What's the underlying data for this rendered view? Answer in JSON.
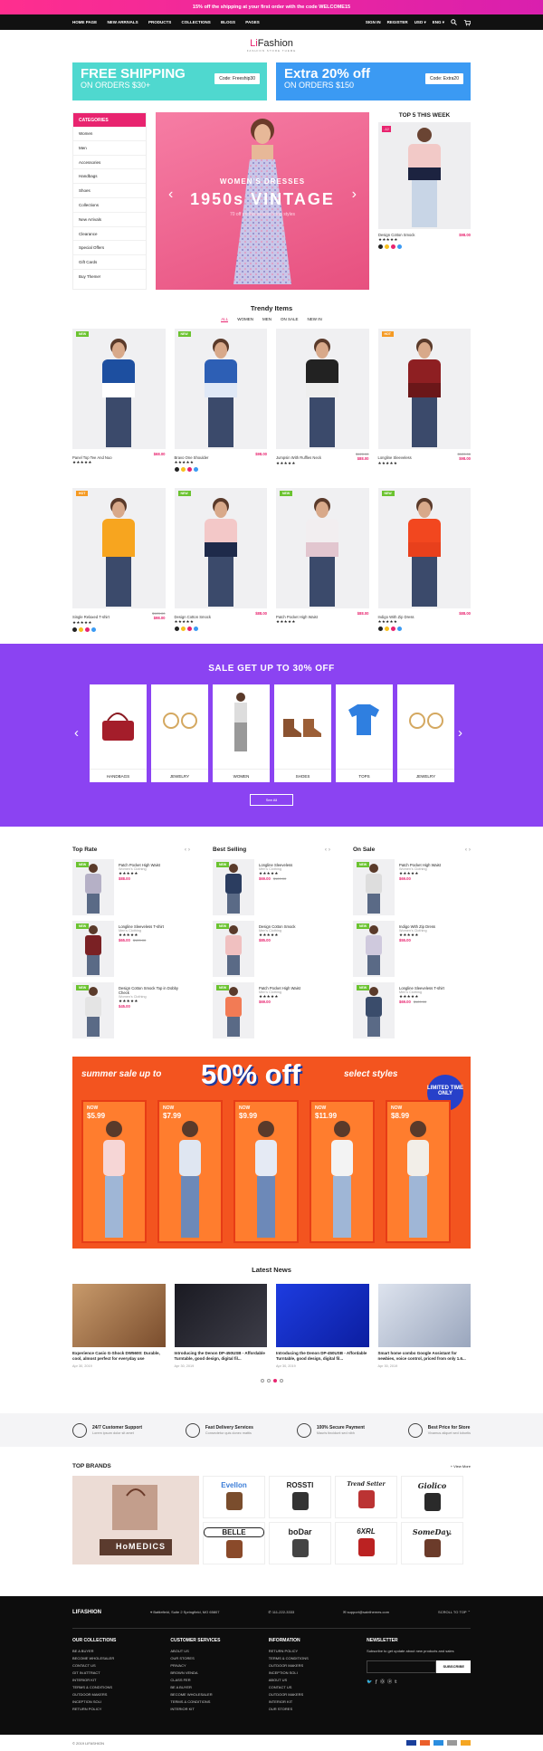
{
  "topbar": {
    "text": "15% off the shipping at your first order with the code WELCOME15"
  },
  "nav": {
    "links": [
      "HOME PAGE",
      "NEW ARRIVALS",
      "PRODUCTS",
      "COLLECTIONS",
      "BLOGS",
      "PAGES"
    ],
    "signin": "SIGN IN",
    "register": "REGISTER",
    "currency": "USD",
    "language": "ENG"
  },
  "logo": {
    "prefix": "Li",
    "name": "Fashion",
    "tagline": "FASHION STORE THEME"
  },
  "promos": [
    {
      "big": "FREE SHIPPING",
      "small": "ON ORDERS $30+",
      "code": "Code: Freeship30",
      "color": "#4fd8cf"
    },
    {
      "big": "Extra 20% off",
      "small": "ON ORDERS $150",
      "code": "Code: Extra20",
      "color": "#3b9af3"
    }
  ],
  "categories": {
    "title": "CATEGORIES",
    "items": [
      "Women",
      "Men",
      "Accessories",
      "Handbags",
      "Shoes",
      "Collections",
      "New Arrivals",
      "Clearance",
      "Special Offers",
      "Gift Cards",
      "Buy Theme!"
    ]
  },
  "banner": {
    "line1": "WOMEN'S DRESSES",
    "line2": "1950s VINTAGE",
    "line3": "70 off on this season's top styles"
  },
  "top5": {
    "title": "TOP 5 THIS WEEK",
    "discount": "-12",
    "name": "Design Cotton Smock",
    "price": "$98.00"
  },
  "trendy": {
    "title": "Trendy Items",
    "tabs": [
      "ALL",
      "WOMEN",
      "MEN",
      "ON SALE",
      "NEW IN"
    ],
    "products": [
      {
        "name": "Panel Top Tee And Nuo",
        "price": "$68.00",
        "old": "",
        "badge": "NEW",
        "btype": "new",
        "bg": "#eef0f3",
        "c1": "#1d4fa0",
        "c2": "#fff"
      },
      {
        "name": "Bravo One Shoulder",
        "price": "$98.00",
        "old": "",
        "badge": "NEW",
        "btype": "new",
        "bg": "#eef0f3",
        "c1": "#2d5fb5",
        "c2": "#dfe8f6"
      },
      {
        "name": "Jumpsin With Ruffles Neck",
        "price": "$88.00",
        "old": "$120.00",
        "badge": "",
        "btype": "",
        "bg": "#eef0f3",
        "c1": "#222",
        "c2": "#eee"
      },
      {
        "name": "Longline Sleeveless",
        "price": "$98.00",
        "old": "$120.00",
        "badge": "HOT",
        "btype": "hot",
        "bg": "#eef0f3",
        "c1": "#8e1f22",
        "c2": "#6b1719"
      },
      {
        "name": "Single Relaxed T-shirt",
        "price": "$98.00",
        "old": "$120.00",
        "badge": "HOT",
        "btype": "hot",
        "bg": "#eef0f3",
        "c1": "#f7a51f",
        "c2": "#f7a51f"
      },
      {
        "name": "Design Cotton Smock",
        "price": "$88.00",
        "old": "",
        "badge": "NEW",
        "btype": "new",
        "bg": "#eef0f3",
        "c1": "#f3c8c8",
        "c2": "#1e2a4a"
      },
      {
        "name": "Patch Pocket High Waist",
        "price": "$88.00",
        "old": "",
        "badge": "NEW",
        "btype": "new",
        "bg": "#eef0f3",
        "c1": "#f2eef0",
        "c2": "#e2c6cf"
      },
      {
        "name": "Indigo With Zip Dress",
        "price": "$88.00",
        "old": "",
        "badge": "NEW",
        "btype": "new",
        "bg": "#eef0f3",
        "c1": "#f2471f",
        "c2": "#e8401c"
      }
    ]
  },
  "sale": {
    "title": "SALE GET UP TO 30% OFF",
    "cats": [
      "HANDBAGS",
      "JEWELRY",
      "WOMEN",
      "SHOES",
      "TOPS",
      "JEWELRY"
    ],
    "see_all": "See All"
  },
  "lists": [
    {
      "title": "Top Rate",
      "items": [
        {
          "name": "Patch Pocket High Waist",
          "cat": "Women's Clothing",
          "price": "$88.00",
          "old": "",
          "badge": "NEW"
        },
        {
          "name": "Longline Sleeveless T-shirt",
          "cat": "Men's Clothing",
          "price": "$65.00",
          "old": "$120.00",
          "badge": "NEW"
        },
        {
          "name": "Design Cotton Smock Top in Dobby Check",
          "cat": "Women's Clothing",
          "price": "$45.00",
          "old": "",
          "badge": "NEW"
        }
      ]
    },
    {
      "title": "Best Selling",
      "items": [
        {
          "name": "Longline Sleeveless",
          "cat": "Men's Clothing",
          "price": "$69.00",
          "old": "$120.00",
          "badge": "NEW"
        },
        {
          "name": "Design Cotton Smock",
          "cat": "Men's Clothing",
          "price": "$85.00",
          "old": "",
          "badge": "NEW"
        },
        {
          "name": "Patch Pocket High Waist",
          "cat": "Men's Clothing",
          "price": "$69.00",
          "old": "",
          "badge": "NEW"
        }
      ]
    },
    {
      "title": "On Sale",
      "items": [
        {
          "name": "Patch Pocket High Waist",
          "cat": "Women's Clothing",
          "price": "$69.00",
          "old": "",
          "badge": "NEW"
        },
        {
          "name": "Indigo With Zip Dress",
          "cat": "Women's Clothing",
          "price": "$55.00",
          "old": "",
          "badge": "NEW"
        },
        {
          "name": "Longline Sleeveless T-shirt",
          "cat": "Men's Clothing",
          "price": "$69.00",
          "old": "$120.00",
          "badge": "NEW"
        }
      ]
    }
  ],
  "summer": {
    "small": "summer sale up to",
    "big": "50% off",
    "tail": "select styles",
    "limited": "LIMITED TIME ONLY",
    "now": "NOW",
    "prices": [
      "$5.99",
      "$7.99",
      "$9.99",
      "$11.99",
      "$8.99"
    ]
  },
  "news": {
    "title": "Latest News",
    "items": [
      {
        "title": "Experience Casio G-Shock DW5600: Durable, cool, almost perfect for everyday use",
        "date": "Apr 30, 2019"
      },
      {
        "title": "Introducing the Denon DP-450USB - Affordable Turntable, good design, digital fil...",
        "date": "Apr 30, 2019"
      },
      {
        "title": "Introducing the Denon DP-450USB - Affordable Turntable, good design, digital fil...",
        "date": "Apr 30, 2019"
      },
      {
        "title": "Smart home combo Google Assistant for newbies, voice control, priced from only 1.6...",
        "date": "Apr 30, 2019"
      }
    ]
  },
  "features": [
    {
      "title": "24/7 Customer Support",
      "sub": "Lorem ipsum dolor sit amet"
    },
    {
      "title": "Fast Delivery Services",
      "sub": "Consectetur quis donec mattis"
    },
    {
      "title": "100% Secure Payment",
      "sub": "Mauris tincidunt sed nibh"
    },
    {
      "title": "Best Price for Store",
      "sub": "Vivamus aliquet sed lobortis"
    }
  ],
  "brands": {
    "title": "TOP BRANDS",
    "view_more": "+ View More",
    "promo": "HoMEDICS",
    "names": [
      "Evellon",
      "ROSSTI",
      "Trend Setter",
      "Giolico",
      "BELLE",
      "boDar",
      "6XRL",
      "SomeDay."
    ]
  },
  "footer": {
    "logo": "LIFASHION",
    "address": "Battlefield, Suite 2 Springfield, MO 65807",
    "phone": "111-222-3333",
    "email": "support@sainthemes.com",
    "scroll": "SCROLL TO TOP",
    "cols": [
      {
        "title": "OUR COLLECTIONS",
        "items": [
          "BE A BUYER",
          "BECOME WHOLESALER",
          "CONTACT US",
          "GIT IN ATTRACT",
          "INTERIOR KIT",
          "TERMS & CONDITIONS",
          "OUTDOOR MAKERS",
          "INCEPTION SOLI",
          "RETURN POLICY"
        ]
      },
      {
        "title": "CUSTOMER SERVICES",
        "items": [
          "ABOUT US",
          "OUR STORES",
          "PRIVACY",
          "BROWN VENDA",
          "CLASS FER",
          "BE A BUYER",
          "BECOME WHOLESALER",
          "TERMS & CONDITIONS",
          "INTERIOR KIT"
        ]
      },
      {
        "title": "INFORMATION",
        "items": [
          "RETURN POLICY",
          "TERMS & CONDITIONS",
          "OUTDOOR MAKERS",
          "INCEPTION SOLI",
          "ABOUT US",
          "CONTACT US",
          "OUTDOOR MAKERS",
          "INTERIOR KIT",
          "OUR STORES"
        ]
      }
    ],
    "newsletter": {
      "title": "NEWSLETTER",
      "text": "Subscribe to get update about new products and sales",
      "button": "SUBSCRIBE"
    },
    "copyright": "© 2019 LIFASHION"
  },
  "colors": {
    "accent": "#e8246f",
    "purple": "#8b43f2",
    "footer": "#0d0d0d"
  }
}
